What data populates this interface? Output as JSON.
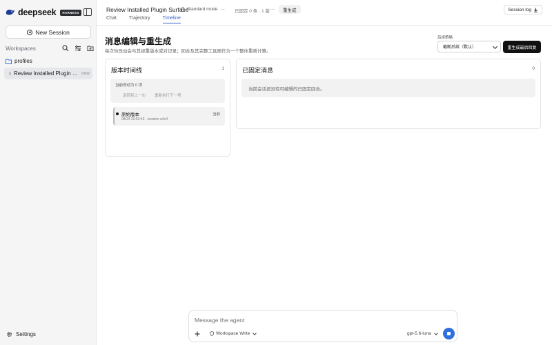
{
  "brand": {
    "name": "deepseek",
    "tag": "HARNESS"
  },
  "sidebar": {
    "new_session_label": "New Session",
    "workspaces_label": "Workspaces",
    "folder_label": "profiles",
    "session": {
      "title": "Review Installed Plugin Surface",
      "time": "now"
    },
    "settings_label": "Settings"
  },
  "topbar": {
    "session_title": "Review Installed Plugin Surface",
    "mode_label": "Standard mode",
    "ellipsis_1": "...",
    "pin_status": "已固定 0 条 · 1 版",
    "ellipsis_2": "...",
    "regen_label": "重生成",
    "session_log_label": "Session log",
    "tabs": [
      {
        "label": "Chat",
        "active": false
      },
      {
        "label": "Trajectory",
        "active": false
      },
      {
        "label": "Timeline",
        "active": true
      }
    ]
  },
  "main": {
    "title": "消息编辑与重生成",
    "subtitle": "每次你改动会与其视重版本或对记录；回合及其完整工具随作为一个整体重新计算。",
    "strategy_label": "后续策略",
    "strategy_value": "截断后续（默认）",
    "regen_button_label": "重生成最后回复",
    "versions": {
      "title": "版本时间线",
      "count": "1",
      "status_label": "当前改动为 0 项",
      "btn_prev": "返回到上一句",
      "btn_next": "重新执行下一项",
      "items": [
        {
          "name": "原始版本",
          "meta": "08/24 20:52:43 · session a4c4",
          "badge": "当前"
        }
      ]
    },
    "pinned": {
      "title": "已固定消息",
      "count": "0",
      "empty_text": "当前会话还没有可编辑的已固定回合。"
    }
  },
  "composer": {
    "placeholder": "Message the agent",
    "workspace_label": "Workspace Write",
    "model_label": "gpt-5.6-luna"
  },
  "colors": {
    "accent": "#2f5ec4",
    "send": "#2f6fde",
    "primary_button": "#111111"
  }
}
